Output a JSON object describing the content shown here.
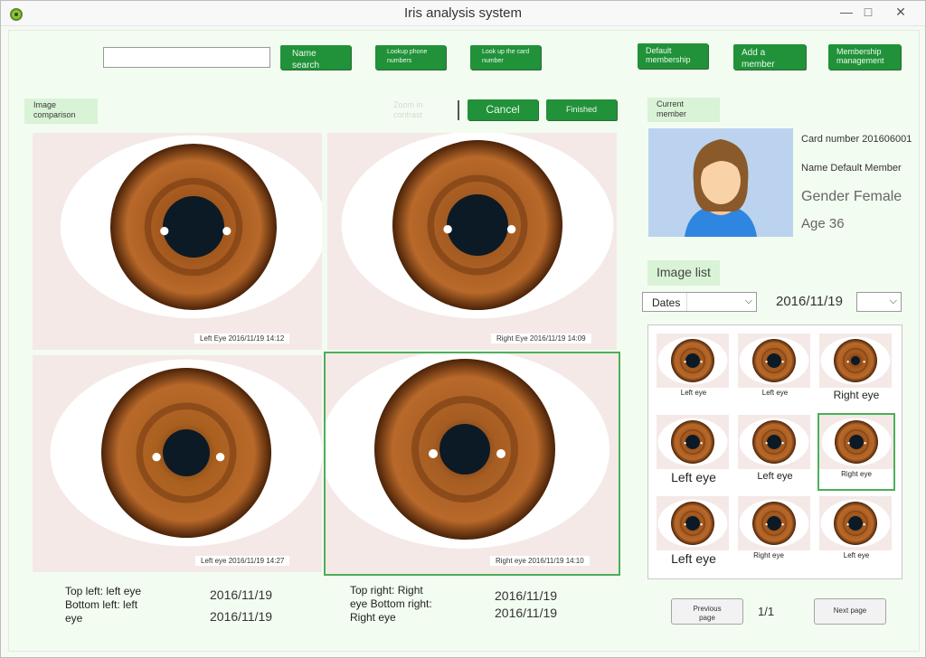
{
  "window": {
    "title": "Iris analysis system",
    "min_symbol": "—",
    "max_symbol": "□",
    "close_symbol": "✕"
  },
  "toolbar": {
    "search_value": "",
    "buttons": {
      "name_search": "Name search",
      "lookup_phone": "Lookup phone numbers",
      "lookup_card": "Look up the card number",
      "default_membership": "Default membership",
      "add_member": "Add a member",
      "membership_management": "Membership management"
    }
  },
  "comparison": {
    "label": "Image comparison",
    "zoom_label": "Zoom in contrast",
    "cancel_label": "Cancel",
    "finished_label": "Finished",
    "panes": [
      {
        "caption": "Left Eye    2016/11/19 14:12"
      },
      {
        "caption": "Right Eye 2016/11/19 14:09"
      },
      {
        "caption": "Left eye      2016/11/19 14:27"
      },
      {
        "caption": "Right eye 2016/11/19 14:10"
      }
    ],
    "summary": {
      "left_text": "Top left: left eye Bottom left: left eye",
      "left_dates": [
        "2016/11/19",
        "2016/11/19"
      ],
      "right_text": "Top right: Right eye Bottom right: Right eye",
      "right_dates": [
        "2016/11/19",
        "2016/11/19"
      ]
    }
  },
  "member": {
    "label": "Current member",
    "card_number": "Card number 201606001",
    "name": "Name Default Member",
    "gender": "Gender Female",
    "age": "Age 36"
  },
  "image_list": {
    "label": "Image list",
    "filter_select": "Dates",
    "date_value": "2016/11/19",
    "thumbs": [
      {
        "caption": "Left eye"
      },
      {
        "caption": "Left eye"
      },
      {
        "caption": "Right eye"
      },
      {
        "caption": "Left eye"
      },
      {
        "caption": "Left eye"
      },
      {
        "caption": "Right eye"
      },
      {
        "caption": "Left eye"
      },
      {
        "caption": "Right eye"
      },
      {
        "caption": "Left eye"
      }
    ],
    "prev_label": "Previous page",
    "next_label": "Next page",
    "page_indicator": "1/1"
  },
  "colors": {
    "accent_green": "#21913a",
    "selection_green": "#4caf5a",
    "iris_brown": "#a0561c"
  }
}
